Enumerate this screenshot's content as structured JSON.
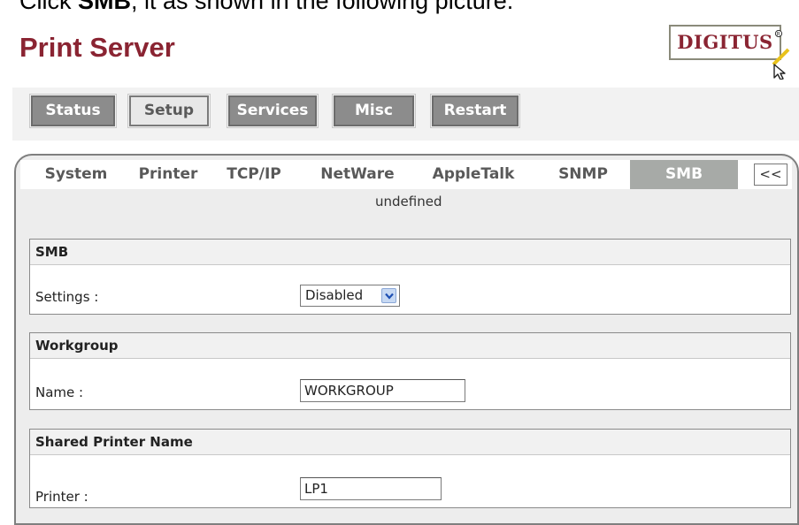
{
  "caption": {
    "prefix": "Click ",
    "bold": "SMB",
    "suffix": ", it as shown in the following picture."
  },
  "app": {
    "title": "Print Server"
  },
  "logo": {
    "text": "DIGITUS",
    "mark": "®",
    "icon": "cursor-arrow-icon",
    "color": "#8a2432"
  },
  "top_nav": [
    {
      "label": "Status"
    },
    {
      "label": "Setup"
    },
    {
      "label": "Services"
    },
    {
      "label": "Misc"
    },
    {
      "label": "Restart"
    }
  ],
  "tabs": [
    {
      "label": "System"
    },
    {
      "label": "Printer"
    },
    {
      "label": "TCP/IP"
    },
    {
      "label": "NetWare"
    },
    {
      "label": "AppleTalk"
    },
    {
      "label": "SNMP"
    },
    {
      "label": "SMB"
    }
  ],
  "tabs_back_label": "<<",
  "status_text": "undefined",
  "smb": {
    "title": "SMB",
    "settings_label": "Settings :",
    "settings_value": "Disabled",
    "settings_icon": "chevron-down-icon"
  },
  "workgroup": {
    "title": "Workgroup",
    "name_label": "Name :",
    "name_value": "WORKGROUP"
  },
  "shared_printer": {
    "title": "Shared Printer Name",
    "printer_label": "Printer :",
    "printer_value": "LP1"
  },
  "colors": {
    "title": "#8a2432",
    "button_bg": "#8c8c8c",
    "button_active_bg": "#e8e8e8",
    "tab_active_bg": "#a7aaa7",
    "panel_bg": "#ededed"
  }
}
